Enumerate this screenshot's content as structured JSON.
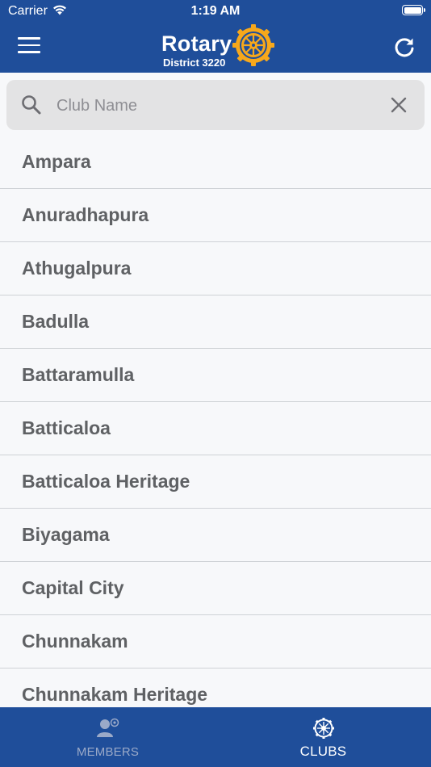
{
  "status_bar": {
    "carrier": "Carrier",
    "time": "1:19 AM"
  },
  "header": {
    "logo_word": "Rotary",
    "logo_district": "District 3220",
    "menu_icon": "hamburger-menu-icon",
    "refresh_icon": "refresh-icon"
  },
  "search": {
    "placeholder": "Club Name",
    "value": "",
    "search_icon": "magnifier-icon",
    "clear_icon": "close-icon"
  },
  "clubs": [
    "Ampara",
    "Anuradhapura",
    "Athugalpura",
    "Badulla",
    "Battaramulla",
    "Batticaloa",
    "Batticaloa Heritage",
    "Biyagama",
    "Capital City",
    "Chunnakam",
    "Chunnakam Heritage"
  ],
  "tabs": [
    {
      "label": "MEMBERS",
      "icon": "members-icon",
      "selected": false
    },
    {
      "label": "CLUBS",
      "icon": "rotary-wheel-icon",
      "selected": true
    }
  ],
  "colors": {
    "brand_blue": "#1f4e9a",
    "rotary_gold": "#f7a81b",
    "list_text": "#5f6164",
    "inactive_tab": "#9aa9c8"
  }
}
